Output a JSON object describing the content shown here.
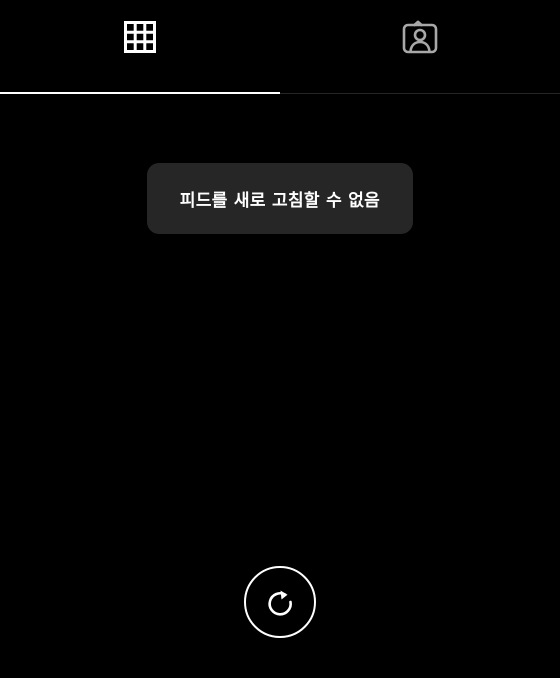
{
  "tabs": [
    {
      "name": "grid",
      "icon": "grid-icon",
      "active": true
    },
    {
      "name": "tagged",
      "icon": "tagged-person-icon",
      "active": false
    }
  ],
  "toast": {
    "message": "피드를 새로 고침할 수 없음"
  },
  "refresh": {
    "icon": "refresh-icon"
  },
  "colors": {
    "background": "#000000",
    "foreground": "#ffffff",
    "toast_background": "#262626",
    "inactive_icon": "#a8a8a8",
    "divider": "#262626"
  }
}
